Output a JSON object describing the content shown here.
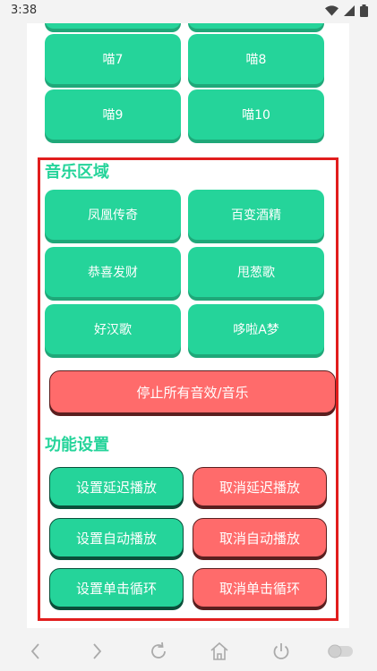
{
  "status": {
    "time": "3:38"
  },
  "meow_rows": [
    {
      "left": "喵7",
      "right": "喵8"
    },
    {
      "left": "喵9",
      "right": "喵10"
    }
  ],
  "music": {
    "title": "音乐区域",
    "buttons": [
      "凤凰传奇",
      "百变酒精",
      "恭喜发财",
      "甩葱歌",
      "好汉歌",
      "哆啦A梦"
    ],
    "stop_label": "停止所有音效/音乐"
  },
  "settings": {
    "title": "功能设置",
    "rows": [
      {
        "set": "设置延迟播放",
        "cancel": "取消延迟播放"
      },
      {
        "set": "设置自动播放",
        "cancel": "取消自动播放"
      },
      {
        "set": "设置单击循环",
        "cancel": "取消单击循环"
      }
    ]
  },
  "colors": {
    "green": "#25d49a",
    "red": "#ff6b6b",
    "highlight": "#e11d1d"
  },
  "nav_icons": [
    "back-icon",
    "forward-icon",
    "refresh-icon",
    "home-icon",
    "power-icon",
    "toggle-icon"
  ]
}
